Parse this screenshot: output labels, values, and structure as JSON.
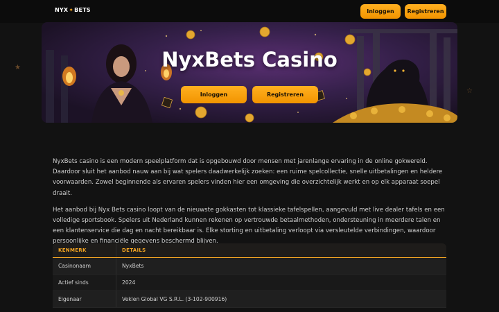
{
  "header": {
    "logo_left": "NYX",
    "logo_right": "BETS",
    "login_label": "Inloggen",
    "register_label": "Registreren"
  },
  "hero": {
    "title": "NyxBets Casino",
    "login_label": "Inloggen",
    "register_label": "Registreren"
  },
  "content": {
    "paragraphs": [
      "NyxBets casino is een modern speelplatform dat is opgebouwd door mensen met jarenlange ervaring in de online gokwereld. Daardoor sluit het aanbod nauw aan bij wat spelers daadwerkelijk zoeken: een ruime spelcollectie, snelle uitbetalingen en heldere voorwaarden. Zowel beginnende als ervaren spelers vinden hier een omgeving die overzichtelijk werkt en op elk apparaat soepel draait.",
      "Het aanbod bij Nyx Bets casino loopt van de nieuwste gokkasten tot klassieke tafelspellen, aangevuld met live dealer tafels en een volledige sportsbook. Spelers uit Nederland kunnen rekenen op vertrouwde betaalmethoden, ondersteuning in meerdere talen en een klantenservice die dag en nacht bereikbaar is. Elke storting en uitbetaling verloopt via versleutelde verbindingen, waardoor persoonlijke en financiële gegevens beschermd blijven."
    ]
  },
  "table": {
    "headers": [
      "KENMERK",
      "DETAILS"
    ],
    "rows": [
      [
        "Casinonaam",
        "NyxBets"
      ],
      [
        "Actief sinds",
        "2024"
      ],
      [
        "Eigenaar",
        "Veklen Global VG S.R.L. (3-102-900916)"
      ]
    ]
  },
  "colors": {
    "accent": "#f5a623",
    "background": "#121212"
  }
}
